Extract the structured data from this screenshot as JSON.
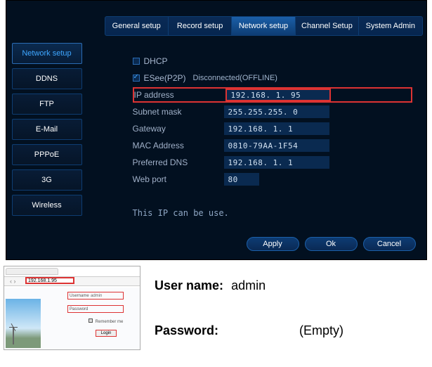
{
  "tabs": [
    "General setup",
    "Record setup",
    "Network setup",
    "Channel Setup",
    "System Admin"
  ],
  "active_tab": 2,
  "sidebar": {
    "items": [
      "Network setup",
      "DDNS",
      "FTP",
      "E-Mail",
      "PPPoE",
      "3G",
      "Wireless"
    ],
    "active": 0
  },
  "net": {
    "dhcp_label": "DHCP",
    "dhcp_checked": false,
    "esee_label": "ESee(P2P)",
    "esee_checked": true,
    "esee_status": "Disconnected(OFFLINE)",
    "ip_label": "IP address",
    "ip_value": "192.168.  1. 95",
    "mask_label": "Subnet mask",
    "mask_value": "255.255.255.  0",
    "gw_label": "Gateway",
    "gw_value": "192.168.  1.  1",
    "mac_label": "MAC Address",
    "mac_value": "0810-79AA-1F54",
    "dns_label": "Preferred DNS",
    "dns_value": "192.168.  1.  1",
    "port_label": "Web port",
    "port_value": "80",
    "note": "This IP can be use."
  },
  "buttons": {
    "apply": "Apply",
    "ok": "Ok",
    "cancel": "Cancel"
  },
  "thumb": {
    "url": "192.168.1.95",
    "user_label": "Username",
    "user_value": "admin",
    "pass_label": "Password",
    "remember": "Remember me",
    "login": "Login"
  },
  "creds": {
    "user_label": "User name:",
    "user_value": "admin",
    "pass_label": "Password:",
    "pass_value": "(Empty)"
  }
}
